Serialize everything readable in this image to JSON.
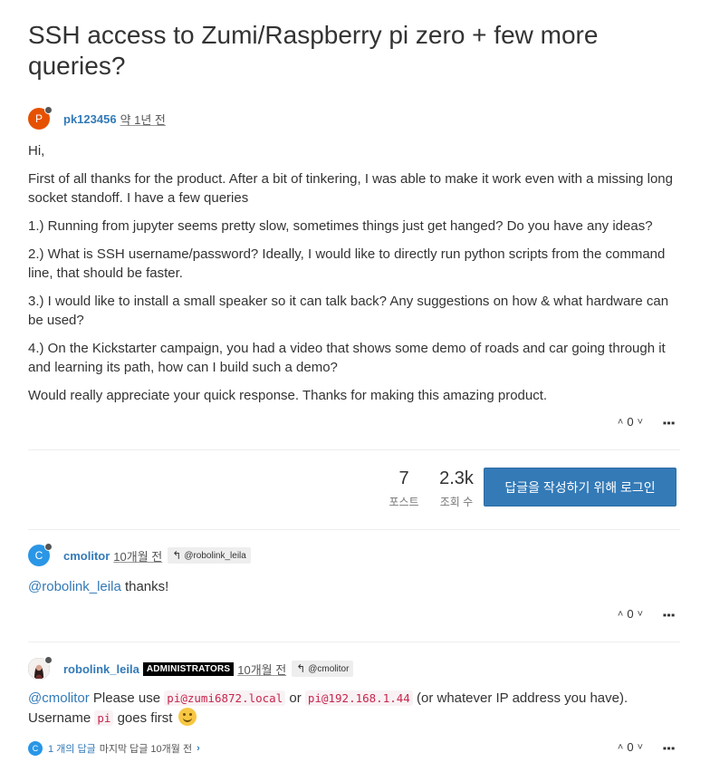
{
  "topic": {
    "title": "SSH access to Zumi/Raspberry pi zero + few more queries?"
  },
  "posts": [
    {
      "avatar_letter": "P",
      "avatar_color": "#e65100",
      "username": "pk123456",
      "time": "약 1년 전",
      "paragraphs": [
        "Hi,",
        "First of all thanks for the product. After a bit of tinkering, I was able to make it work even with a missing long socket standoff. I have a few queries",
        "1.) Running from jupyter seems pretty slow, sometimes things just get hanged? Do you have any ideas?",
        "2.) What is SSH username/password? Ideally, I would like to directly run python scripts from the command line, that should be faster.",
        "3.) I would like to install a small speaker so it can talk back? Any suggestions on how & what hardware can be used?",
        "4.) On the Kickstarter campaign, you had a video that shows some demo of roads and car going through it and learning its path, how can I build such a demo?",
        "Would really appreciate your quick response. Thanks for making this amazing product."
      ],
      "votes": "0"
    },
    {
      "avatar_letter": "C",
      "avatar_color": "#2a96e6",
      "username": "cmolitor",
      "time": "10개월 전",
      "reply_to": "@robolink_leila",
      "mention": "@robolink_leila",
      "text": " thanks!",
      "votes": "0"
    },
    {
      "username": "robolink_leila",
      "badge": "ADMINISTRATORS",
      "time": "10개월 전",
      "reply_to": "@cmolitor",
      "mention": "@cmolitor",
      "text_1": " Please use ",
      "code_1": "pi@zumi6872.local",
      "text_2": " or ",
      "code_2": "pi@192.168.1.44",
      "text_3": " (or whatever IP address you have).",
      "text_4": "Username ",
      "code_3": "pi",
      "text_5": " goes first ",
      "votes": "0",
      "replies": {
        "avatar_letter": "C",
        "count_text": "1 개의 답글",
        "last_text": "마지막 답글 10개월 전"
      }
    }
  ],
  "stats": {
    "posts_value": "7",
    "posts_label": "포스트",
    "views_value": "2.3k",
    "views_label": "조회 수"
  },
  "login_button": "답글을 작성하기 위해 로그인",
  "colors": {
    "accent": "#337ab7",
    "code": "#c7254e"
  },
  "icons": [
    "reply-arrow-icon",
    "chevron-up-icon",
    "chevron-down-icon",
    "more-vertical-icon",
    "smile-emoji-icon",
    "chevron-right-icon"
  ]
}
